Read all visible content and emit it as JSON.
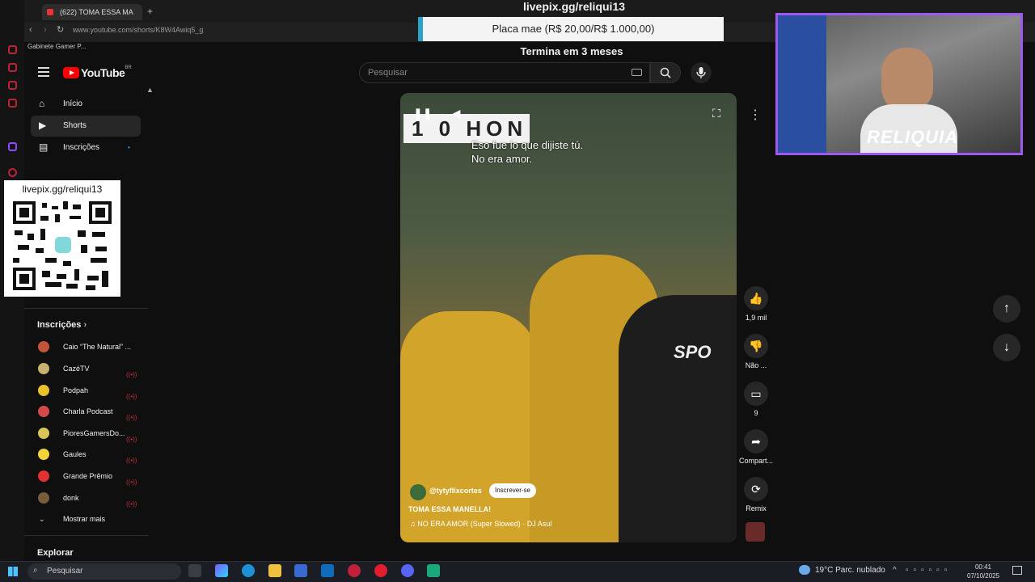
{
  "browser": {
    "tab_title": "(622) TOMA ESSA MA",
    "url": "www.youtube.com/shorts/K8W4Awiq5_g",
    "bookmark": "Gabinete Gamer P..."
  },
  "youtube": {
    "logo_text": "YouTube",
    "region": "BR",
    "search_placeholder": "Pesquisar"
  },
  "sidebar": {
    "items": [
      {
        "label": "Início",
        "icon": "home-icon"
      },
      {
        "label": "Shorts",
        "icon": "shorts-icon"
      },
      {
        "label": "Inscrições",
        "icon": "subscriptions-icon"
      }
    ],
    "subscriptions_header": "Inscrições",
    "channels": [
      {
        "name": "Caio “The Natural” ...",
        "color": "#c0553a"
      },
      {
        "name": "CazéTV",
        "color": "#c9b070"
      },
      {
        "name": "Podpah",
        "color": "#e8c22a"
      },
      {
        "name": "Charla Podcast",
        "color": "#d24a4a"
      },
      {
        "name": "PioresGamersDo...",
        "color": "#d9c45a"
      },
      {
        "name": "Gaules",
        "color": "#f2d33a"
      },
      {
        "name": "Grande Prêmio",
        "color": "#e33030"
      },
      {
        "name": "donk",
        "color": "#7a5c3a"
      }
    ],
    "show_more": "Mostrar mais",
    "explore": "Explorar"
  },
  "stream_overlay": {
    "livepix_top": "livepix.gg/reliqui13",
    "goal_text": "Placa mae (R$ 20,00/R$ 1.000,00)",
    "goal_ends": "Termina em 3 meses",
    "qr_text": "livepix.gg/reliqui13",
    "webcam_brand": "RELIQUIA"
  },
  "video": {
    "scoreboard": "1 0 HON",
    "caption_line1": "Eso fue lo que dijiste tú.",
    "caption_line2": "No era amor.",
    "jersey_text": "SPO",
    "channel": "@tytyflixcortes",
    "subscribe_label": "Inscrever-se",
    "title": "TOMA ESSA MANELLA!",
    "music": "NO ERA AMOR (Super Slowed) · DJ Asul"
  },
  "actions": {
    "like_count": "1,9 mil",
    "dislike_label": "Não ...",
    "comment_count": "9",
    "share_label": "Compart...",
    "remix_label": "Remix"
  },
  "taskbar": {
    "search_placeholder": "Pesquisar",
    "weather": "19°C  Parc. nublado",
    "time": "00:41",
    "date": "07/10/2025"
  }
}
